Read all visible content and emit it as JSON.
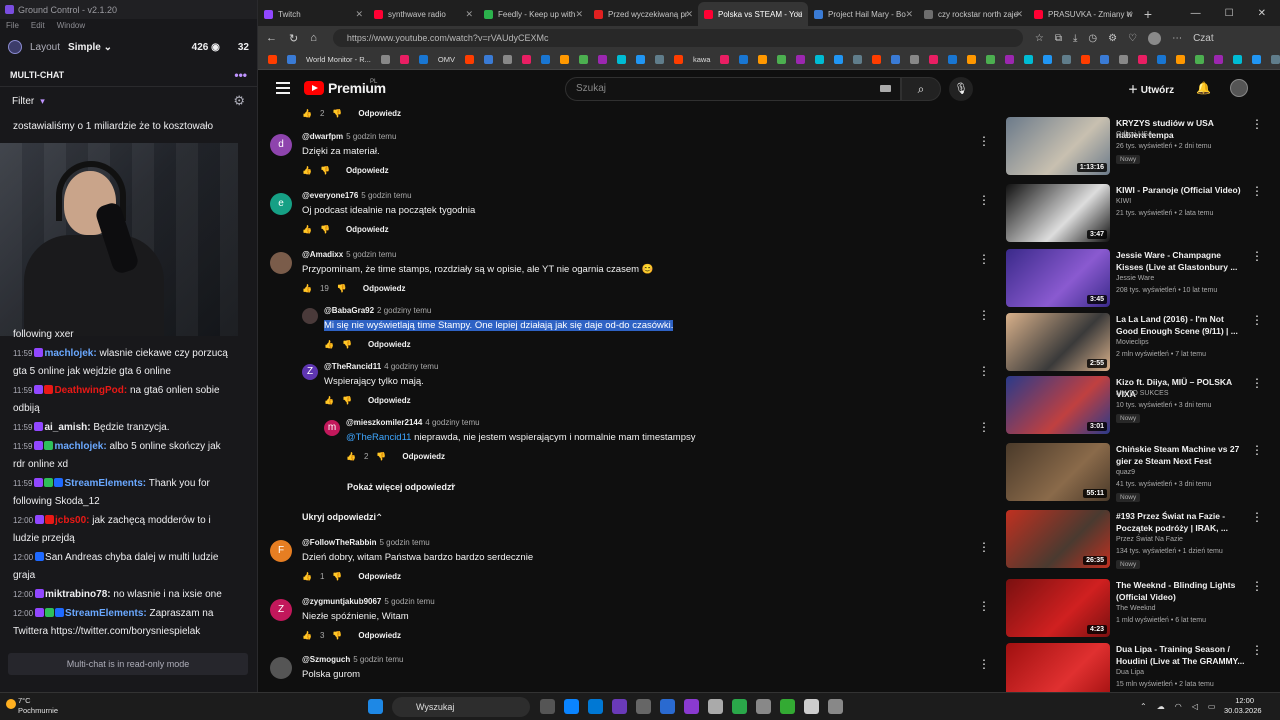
{
  "gc": {
    "title": "Ground Control - v2.1.20",
    "menu": [
      "File",
      "Edit",
      "Window"
    ],
    "layout_label": "Layout",
    "layout_value": "Simple",
    "viewers": "426",
    "stat2": "32",
    "multichat": "MULTI-CHAT",
    "filter": "Filter",
    "pinned": "zostawialiśmy o 1 miliardzie że to kosztowało",
    "readonly": "Multi-chat is in read-only mode"
  },
  "chat": [
    {
      "time": "",
      "user": "",
      "text": "following xxer",
      "color": "#efeff1"
    },
    {
      "time": "11:59",
      "user": "machlojek:",
      "text": " wlasnie ciekawe czy porzucą gta 5 online jak wejdzie gta 6 online",
      "color": "#6aa8ff"
    },
    {
      "time": "11:59",
      "user": "DeathwingPod:",
      "text": " na gta6 onlien sobie odbiją",
      "color": "#e91916"
    },
    {
      "time": "11:59",
      "user": "ai_amish:",
      "text": " Będzie tranzycja.",
      "color": "#efeff1"
    },
    {
      "time": "11:59",
      "user": "machlojek:",
      "text": " albo 5 online skończy jak rdr online xd",
      "color": "#6aa8ff"
    },
    {
      "time": "11:59",
      "user": "StreamElements:",
      "text": " Thank you for following Skoda_12",
      "color": "#6aa8ff"
    },
    {
      "time": "12:00",
      "user": "jcbs00:",
      "text": " jak zachęcą modderów to i ludzie przejdą",
      "color": "#e91916"
    },
    {
      "time": "12:00",
      "user": "",
      "text": "San Andreas chyba dalej w multi ludzie graja",
      "color": "#efeff1"
    },
    {
      "time": "12:00",
      "user": "miktrabino78:",
      "text": " no wlasnie i na ixsie one",
      "color": "#efeff1"
    },
    {
      "time": "12:00",
      "user": "StreamElements:",
      "text": " Zapraszam na Twittera https://twitter.com/borysniespielak",
      "color": "#6aa8ff"
    }
  ],
  "tabs": [
    {
      "label": "Twitch",
      "color": "#9147ff"
    },
    {
      "label": "synthwave radio",
      "color": "#ff0033"
    },
    {
      "label": "Feedly - Keep up with",
      "color": "#2bb24c"
    },
    {
      "label": "Przed wyczekiwaną pr",
      "color": "#e02020"
    },
    {
      "label": "Polska vs STEAM - You",
      "color": "#ff0033",
      "active": true
    },
    {
      "label": "Project Hail Mary - Bo",
      "color": "#3a7bd5"
    },
    {
      "label": "czy rockstar north zaje",
      "color": "#6d6d6d"
    },
    {
      "label": "PRASUVKA - Zmiany w",
      "color": "#ff0033"
    }
  ],
  "address": {
    "url": "https://www.youtube.com/watch?v=rVAUdyCEXMc",
    "profile": "Czat"
  },
  "bookmarks": [
    "World Monitor - R...",
    "OMV",
    "kawa"
  ],
  "yt": {
    "brand": "Premium",
    "region": "PL",
    "search_placeholder": "Szukaj",
    "create": "Utwórz"
  },
  "comments": [
    {
      "id": "c0",
      "user": "",
      "time": "",
      "text": "",
      "likes": "2",
      "reply": "Odpowiedz"
    },
    {
      "id": "c1",
      "initial": "d",
      "avatar": "#8e44ad",
      "user": "@dwarfpm",
      "time": "5 godzin temu",
      "text": "Dzięki za materiał.",
      "likes": "",
      "reply": "Odpowiedz"
    },
    {
      "id": "c2",
      "initial": "e",
      "avatar": "#16a085",
      "user": "@everyone176",
      "time": "5 godzin temu",
      "text": "Oj podcast idealnie na początek tygodnia",
      "likes": "",
      "reply": "Odpowiedz"
    },
    {
      "id": "c3",
      "initial": "",
      "avatar": "#7a5c4a",
      "user": "@Amadixx",
      "time": "5 godzin temu",
      "text": "Przypominam, że time stamps, rozdziały są w opisie, ale YT nie ogarnia czasem 😊",
      "likes": "19",
      "reply": "Odpowiedz"
    },
    {
      "id": "c4",
      "initial": "",
      "avatar": "#4a3a3a",
      "user": "@BabaGra92",
      "time": "2 godziny temu",
      "text": "Mi się nie wyświetlają time Stampy. One lepiej działają jak się daje od-do czasówki.",
      "likes": "",
      "reply": "Odpowiedz"
    },
    {
      "id": "c5",
      "initial": "Z",
      "avatar": "#5e35b1",
      "user": "@TheRancid11",
      "time": "4 godziny temu",
      "text": "Wspierający tylko mają.",
      "likes": "",
      "reply": "Odpowiedz"
    },
    {
      "id": "c6",
      "initial": "m",
      "avatar": "#c2185b",
      "user": "@mieszkomiler2144",
      "time": "4 godziny temu",
      "mention": "@TheRancid11",
      "text": " nieprawda, nie jestem wspierającym i normalnie mam timestampsy",
      "likes": "2",
      "reply": "Odpowiedz"
    },
    {
      "id": "c7",
      "initial": "F",
      "avatar": "#e67e22",
      "user": "@FollowTheRabbin",
      "time": "5 godzin temu",
      "text": "Dzień dobry, witam Państwa bardzo bardzo serdecznie",
      "likes": "1",
      "reply": "Odpowiedz"
    },
    {
      "id": "c8",
      "initial": "Z",
      "avatar": "#c2185b",
      "user": "@zygmuntjakub9067",
      "time": "5 godzin temu",
      "text": "Niezłe spóźnienie, Witam",
      "likes": "3",
      "reply": "Odpowiedz"
    },
    {
      "id": "c9",
      "initial": "",
      "avatar": "#555",
      "user": "@Szmoguch",
      "time": "5 godzin temu",
      "text": "Polska gurom",
      "likes": "",
      "reply": ""
    }
  ],
  "more_replies": "Pokaż więcej odpowiedzi",
  "hide_replies": "Ukryj odpowiedzi",
  "videos": [
    {
      "title": "KRYZYS studiów w USA nabiera tempa",
      "channel": "Odkryj USA",
      "meta": "26 tys. wyświetleń • 2 dni temu",
      "badge": "Nowy",
      "dur": "1:13:16",
      "c1": "#6b7a8a",
      "c2": "#c8c0b0"
    },
    {
      "title": "KIWI - Paranoje (Official Video)",
      "channel": "KIWI",
      "meta": "21 tys. wyświetleń • 2 lata temu",
      "badge": "",
      "dur": "3:47",
      "c1": "#111",
      "c2": "#ddd"
    },
    {
      "title": "Jessie Ware - Champagne Kisses (Live at Glastonbury ...",
      "channel": "Jessie Ware",
      "meta": "208 tys. wyświetleń • 10 lat temu",
      "badge": "",
      "dur": "3:45",
      "c1": "#3a2a8a",
      "c2": "#8a5ad0"
    },
    {
      "title": "La La Land (2016) - I'm Not Good Enough Scene (9/11) | ...",
      "channel": "Movieclips",
      "meta": "2 mln wyświetleń • 7 lat temu",
      "badge": "",
      "dur": "2:55",
      "c1": "#d8b08a",
      "c2": "#3a3a3a"
    },
    {
      "title": "Kizo ft. Diiya, MIÜ – POLSKA VIXA",
      "channel": "MY TO SUKCES",
      "meta": "10 tys. wyświetleń • 3 dni temu",
      "badge": "Nowy",
      "dur": "3:01",
      "c1": "#2a3a8a",
      "c2": "#c04040"
    },
    {
      "title": "Chińskie Steam Machine vs 27 gier ze Steam Next Fest",
      "channel": "quaz9",
      "meta": "41 tys. wyświetleń • 3 dni temu",
      "badge": "Nowy",
      "dur": "55:11",
      "c1": "#4a3a2a",
      "c2": "#8a6a4a"
    },
    {
      "title": "#193 Przez Świat na Fazie - Początek podróży | IRAK, ...",
      "channel": "Przez Świat Na Fazie",
      "meta": "134 tys. wyświetleń • 1 dzień temu",
      "badge": "Nowy",
      "dur": "26:35",
      "c1": "#c03020",
      "c2": "#4a3a30"
    },
    {
      "title": "The Weeknd - Blinding Lights (Official Video)",
      "channel": "The Weeknd",
      "meta": "1 mld wyświetleń • 6 lat temu",
      "badge": "",
      "dur": "4:23",
      "c1": "#7a1010",
      "c2": "#d02020"
    },
    {
      "title": "Dua Lipa - Training Season / Houdini (Live at The GRAMMY...",
      "channel": "Dua Lipa",
      "meta": "15 mln wyświetleń • 2 lata temu",
      "badge": "",
      "dur": "",
      "c1": "#a01010",
      "c2": "#e03030"
    }
  ],
  "taskbar": {
    "temp": "7°C",
    "weather": "Pochmurnie",
    "search": "Wyszukaj",
    "time": "12:00",
    "date": "30.03.2026"
  }
}
